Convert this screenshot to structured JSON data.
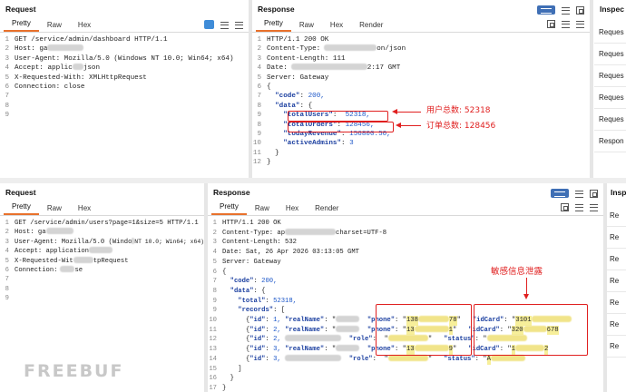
{
  "top": {
    "request": {
      "title": "Request",
      "tabs": [
        "Pretty",
        "Raw",
        "Hex"
      ],
      "lines": [
        "GET /service/admin/dashboard HTTP/1.1",
        "Host: ga",
        "User-Agent: Mozilla/5.0 (Windows NT 10.0; Win64; x64)",
        "Accept: applic",
        "X-Requested-With: XMLHttpRequest",
        "Connection: close",
        "",
        "",
        ""
      ],
      "accept_tail": "json"
    },
    "response": {
      "title": "Response",
      "tabs": [
        "Pretty",
        "Raw",
        "Hex",
        "Render"
      ],
      "status_line": "HTTP/1.1 200 OK",
      "content_type_label": "Content-Type:",
      "content_type_tail": "on/json",
      "content_length": "Content-Length: 111",
      "date_label": "Date:",
      "date_tail": "2:17 GMT",
      "server": "Server: Gateway",
      "code_key": "\"code\"",
      "code_val": "200,",
      "data_key": "\"data\"",
      "total_users_key": "\"totalUsers\"",
      "total_users_val": "52318,",
      "total_orders_key": "\"totalOrders\"",
      "total_orders_val": "128456,",
      "today_revenue_key": "\"todayRevenue\"",
      "today_revenue_val": "156800.50,",
      "active_admins_key": "\"activeAdmins\"",
      "active_admins_val": "3"
    },
    "annotations": {
      "users": "用户总数: 52318",
      "orders": "订单总数: 128456"
    },
    "inspector": {
      "title": "Inspec",
      "items": [
        "Reques",
        "Reques",
        "Reques",
        "Reques",
        "Reques",
        "Respon"
      ]
    }
  },
  "bottom": {
    "request": {
      "title": "Request",
      "tabs": [
        "Pretty",
        "Raw",
        "Hex"
      ],
      "lines": [
        "GET /service/admin/users?page=1&size=5 HTTP/1.1",
        "Host: ga",
        "User-Agent: Mozilla/5.0 (Windo",
        "Accept: application",
        "X-Requested-Wit",
        "Connection:",
        "",
        "",
        ""
      ],
      "ua_tail": "NT 10.0; Win64; x64)",
      "xrw_tail": "tpRequest",
      "conn_tail": "se"
    },
    "response": {
      "title": "Response",
      "tabs": [
        "Pretty",
        "Raw",
        "Hex",
        "Render"
      ],
      "status_line": "HTTP/1.1 200 OK",
      "content_type_label": "Content-Type: ap",
      "content_type_tail": "charset=UTF-8",
      "content_length": "Content-Length: 532",
      "date": "Date: Sat, 26 Apr 2026 03:13:05 GMT",
      "server": "Server: Gateway",
      "total_val": "52318,",
      "records": [
        {
          "id": "1,",
          "f2": "\"phone\"",
          "f3": "\"idCard\"",
          "n1": "138",
          "n2": "78",
          "c1": "3101"
        },
        {
          "id": "2,",
          "f2": "\"phone\"",
          "f3": "\"idCard\"",
          "n1": "13",
          "n2": "1",
          "c1": "320",
          "c2": "678"
        },
        {
          "id": "2,",
          "f2": "\"role\"",
          "f3": "\"status\"",
          "n1": "",
          "n2": "",
          "c1": ""
        },
        {
          "id": "3,",
          "f2": "\"phone\"",
          "f3": "\"idCard\"",
          "n1": "13",
          "n2": "9",
          "c1": "1",
          "c2": "2"
        },
        {
          "id": "3,",
          "f2": "\"role\"",
          "f3": "\"status\"",
          "n1": "",
          "n2": "",
          "c1": "A"
        }
      ]
    },
    "annotation_leak": "敏感信息泄露",
    "inspector": {
      "title": "Insp",
      "items": [
        "Re",
        "Re",
        "Re",
        "Re",
        "Re",
        "Re",
        "Re"
      ]
    }
  },
  "watermark": "FREEBUF",
  "colors": {
    "annotation": "#e02020",
    "accent_tab": "#e8712c",
    "key": "#1b3fa0",
    "highlight": "#f7ef9a"
  }
}
